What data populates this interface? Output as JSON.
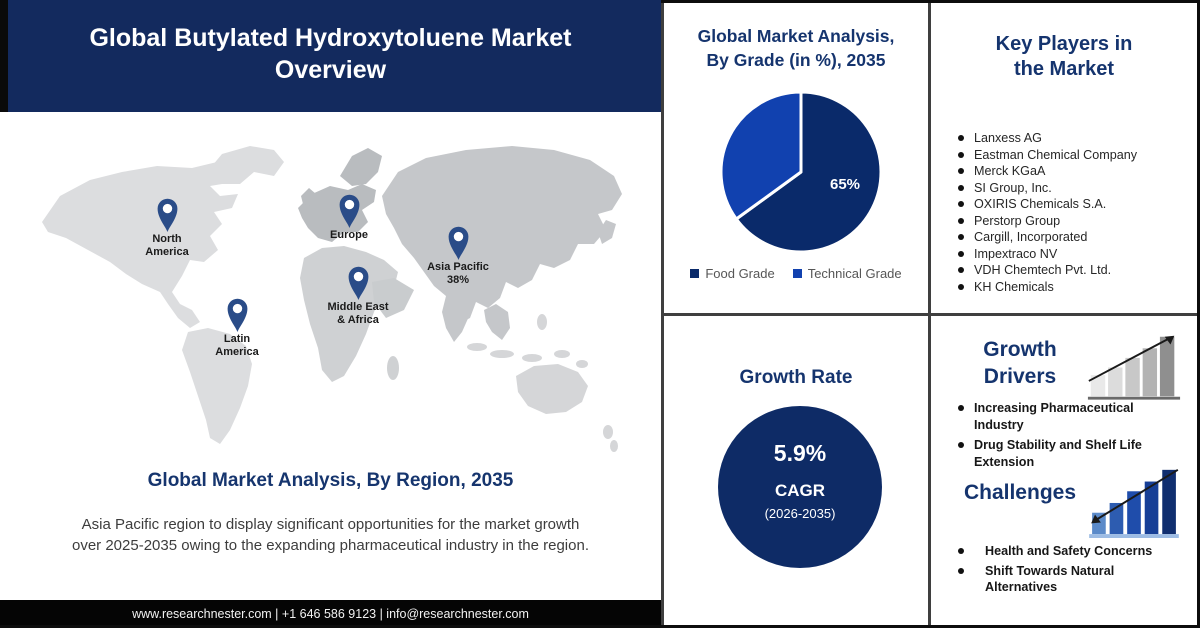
{
  "banner": {
    "title": "Global Butylated Hydroxytoluene Market Overview",
    "title_lines": [
      "Global Butylated Hydroxytoluene Market",
      "Overview"
    ]
  },
  "map": {
    "heading": "Global Market Analysis, By Region, 2035",
    "description": "Asia Pacific region to display significant opportunities for the market growth over 2025-2035 owing to the expanding pharmaceutical industry in the region.",
    "pins": [
      {
        "region": "North America",
        "lines": [
          "North",
          "America"
        ]
      },
      {
        "region": "Europe",
        "lines": [
          "Europe",
          ""
        ]
      },
      {
        "region": "Asia Pacific",
        "lines": [
          "Asia Pacific",
          "38%"
        ]
      },
      {
        "region": "Middle East & Africa",
        "lines": [
          "Middle East",
          "& Africa"
        ]
      },
      {
        "region": "Latin America",
        "lines": [
          "Latin",
          "America"
        ]
      }
    ]
  },
  "pie_panel": {
    "title_lines": [
      "Global Market Analysis,",
      "By Grade (in %), 2035"
    ],
    "slice_label": "65%",
    "legend": [
      {
        "label": "Food Grade",
        "color": "#0a2a6a"
      },
      {
        "label": "Technical Grade",
        "color": "#1141af"
      }
    ]
  },
  "growth_rate": {
    "title": "Growth Rate",
    "value": "5.9%",
    "metric": "CAGR",
    "period": "(2026-2035)"
  },
  "key_players": {
    "title_lines": [
      "Key Players in",
      "the Market"
    ],
    "companies": [
      "Lanxess AG",
      "Eastman Chemical Company",
      "Merck KGaA",
      "SI Group, Inc.",
      "OXIRIS Chemicals S.A.",
      "Perstorp Group",
      "Cargill, Incorporated",
      "Impextraco NV",
      "VDH Chemtech Pvt. Ltd.",
      "KH Chemicals"
    ]
  },
  "growth_drivers": {
    "title_lines": [
      "Growth",
      "Drivers"
    ],
    "items": [
      "Increasing Pharmaceutical Industry",
      "Drug Stability and Shelf Life Extension"
    ]
  },
  "challenges": {
    "title": "Challenges",
    "items": [
      "Health and Safety Concerns",
      "Shift Towards Natural Alternatives"
    ]
  },
  "footer": {
    "text": "www.researchnester.com | +1 646 586 9123 | info@researchnester.com"
  },
  "colors": {
    "banner_bg": "#132a5e",
    "heading_navy": "#15346e",
    "pie_food_grade": "#0a2a6a",
    "pie_technical_grade": "#1141af",
    "growth_circle": "#0e2b66",
    "map_pin": "#2a4c88",
    "footer_bg": "#050505"
  },
  "chart_data": [
    {
      "type": "pie",
      "title": "Global Market Analysis, By Grade (in %), 2035",
      "labels": [
        "Food Grade",
        "Technical Grade"
      ],
      "values": [
        65,
        35
      ],
      "colors": [
        "#0a2a6a",
        "#1141af"
      ],
      "data_labels": [
        "65%",
        ""
      ],
      "start_angle_deg": 0,
      "direction": "clockwise",
      "legend_position": "bottom"
    },
    {
      "type": "map",
      "title": "Global Market Analysis, By Region, 2035",
      "regions": [
        "North America",
        "Europe",
        "Asia Pacific",
        "Middle East & Africa",
        "Latin America"
      ],
      "values": [
        null,
        null,
        38,
        null,
        null
      ],
      "annotation": "Asia Pacific 38%"
    },
    {
      "type": "kpi",
      "title": "Growth Rate",
      "value": "5.9%",
      "metric": "CAGR",
      "period": "(2026-2035)"
    }
  ]
}
